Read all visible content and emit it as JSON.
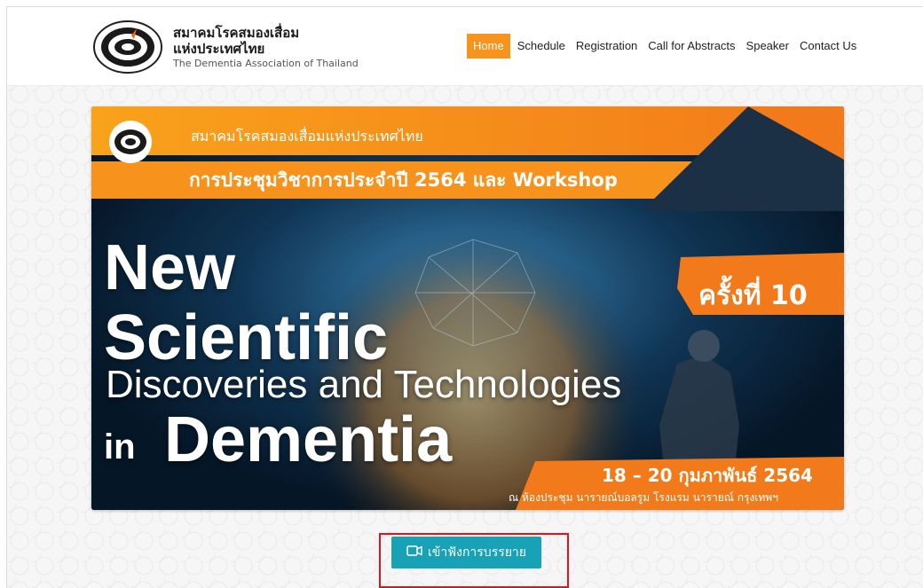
{
  "header": {
    "brand_thai_line1": "สมาคมโรคสมองเสื่อม",
    "brand_thai_line2": "แห่งประเทศไทย",
    "brand_english": "The Dementia Association of Thailand"
  },
  "nav": {
    "items": [
      {
        "label": "Home",
        "active": true
      },
      {
        "label": "Schedule",
        "active": false
      },
      {
        "label": "Registration",
        "active": false
      },
      {
        "label": "Call for Abstracts",
        "active": false
      },
      {
        "label": "Speaker",
        "active": false
      },
      {
        "label": "Contact Us",
        "active": false
      }
    ]
  },
  "banner": {
    "org_name": "สมาคมโรคสมองเสื่อมแห่งประเทศไทย",
    "conference": "การประชุมวิชาการประจำปี 2564 และ Workshop",
    "title_line1": "New",
    "title_line2": "Scientific",
    "title_line3": "Discoveries and Technologies",
    "title_in": "in",
    "title_line4": "Dementia",
    "edition": "ครั้งที่ 10",
    "date": "18 – 20 กุมภาพันธ์ 2564",
    "venue": "ณ ห้องประชุม นารายณ์บอลรูม โรงแรม นารายณ์ กรุงเทพฯ"
  },
  "cta": {
    "label": "เข้าฟังการบรรยาย",
    "icon": "video-camera-icon"
  },
  "colors": {
    "accent_orange": "#f7941d",
    "button_teal": "#17a2b8",
    "highlight_red": "#e0141c"
  }
}
